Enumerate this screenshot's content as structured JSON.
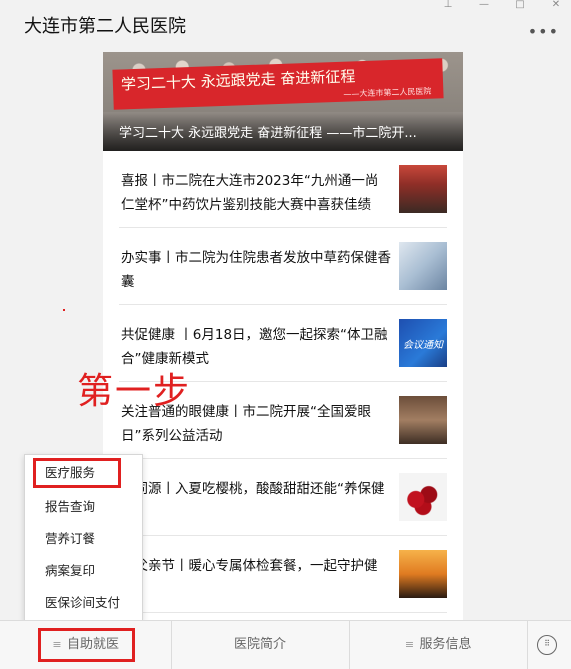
{
  "window": {
    "title": "大连市第二人民医院",
    "controls": [
      "⊥",
      "—",
      "□",
      "✕"
    ],
    "more_icon": "•••"
  },
  "banner": {
    "slogan": "学习二十大  永远跟党走  奋进新征程",
    "slogan_sub": "——大连市第二人民医院",
    "caption": "学习二十大 永远跟党走 奋进新征程 ——市二院开..."
  },
  "articles": [
    {
      "title": "喜报丨市二院在大连市2023年“九州通一尚仁堂杯”中药饮片鉴别技能大赛中喜获佳绩",
      "thumb_icon": "award-ceremony-photo"
    },
    {
      "title": "办实事丨市二院为住院患者发放中草药保健香囊",
      "thumb_icon": "ward-visit-photo"
    },
    {
      "title": "共促健康 丨6月18日，邀您一起探索“体卫融合”健康新模式",
      "thumb_icon": "meeting-notice-image",
      "thumb_text": "会议通知"
    },
    {
      "title": "关注普通的眼健康丨市二院开展“全国爱眼日”系列公益活动",
      "thumb_icon": "lecture-hall-photo"
    },
    {
      "title": "食同源丨入夏吃樱桃，酸酸甜甜还能“养保健",
      "thumb_icon": "cherries-photo"
    },
    {
      "title": "恩父亲节丨暖心专属体检套餐，一起守护健康！",
      "thumb_icon": "father-child-sunset-photo"
    }
  ],
  "annotation": {
    "step_label": "第一步",
    "color": "#e02020"
  },
  "menu": {
    "items": [
      "医疗服务",
      "报告查询",
      "营养订餐",
      "病案复印",
      "医保诊间支付"
    ]
  },
  "bottom_bar": {
    "tabs": [
      "自助就医",
      "医院简介",
      "服务信息"
    ],
    "keyboard_icon": "keyboard-icon"
  }
}
